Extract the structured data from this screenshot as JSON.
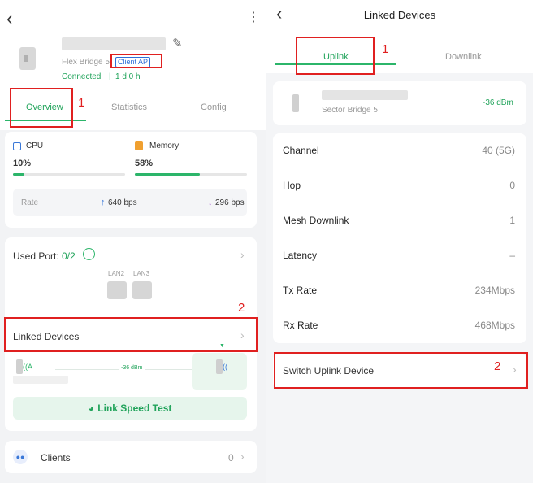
{
  "left": {
    "device_model": "Flex Bridge 5",
    "mode_badge": "Client AP",
    "status": "Connected",
    "uptime": "1 d 0 h",
    "tabs": [
      {
        "label": "Overview",
        "active": true
      },
      {
        "label": "Statistics",
        "active": false
      },
      {
        "label": "Config",
        "active": false
      }
    ],
    "annot_1": "1",
    "annot_2": "2",
    "cpu": {
      "label": "CPU",
      "value": "10%",
      "fraction": 0.1
    },
    "memory": {
      "label": "Memory",
      "value": "58%",
      "fraction": 0.58
    },
    "rate": {
      "label": "Rate",
      "up": "640 bps",
      "down": "296 bps"
    },
    "used_port": {
      "label": "Used Port:",
      "value": "0/2",
      "ports": [
        "LAN2",
        "LAN3"
      ]
    },
    "linked_devices": {
      "label": "Linked Devices",
      "signal": "-36 dBm"
    },
    "speed_test_label": "Link Speed Test",
    "clients": {
      "label": "Clients",
      "count": "0"
    }
  },
  "right": {
    "title": "Linked Devices",
    "tabs": [
      {
        "label": "Uplink",
        "active": true
      },
      {
        "label": "Downlink",
        "active": false
      }
    ],
    "annot_1": "1",
    "annot_2": "2",
    "device": {
      "model": "Sector Bridge 5",
      "signal": "-36 dBm"
    },
    "rows": [
      {
        "key": "Channel",
        "value": "40  (5G)"
      },
      {
        "key": "Hop",
        "value": "0"
      },
      {
        "key": "Mesh Downlink",
        "value": "1"
      },
      {
        "key": "Latency",
        "value": "–"
      },
      {
        "key": "Tx Rate",
        "value": "234Mbps"
      },
      {
        "key": "Rx Rate",
        "value": "468Mbps"
      }
    ],
    "switch_label": "Switch Uplink Device"
  },
  "colors": {
    "accent": "#20a35a",
    "annotation": "#e02020",
    "badge": "#2f6fd8"
  }
}
